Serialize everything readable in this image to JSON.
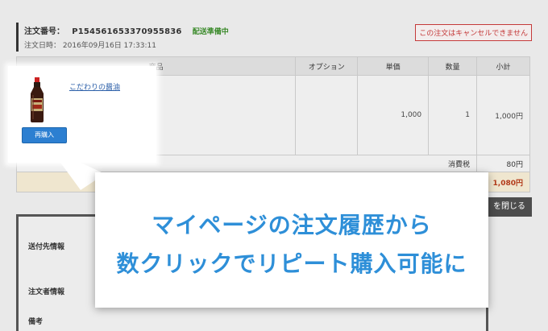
{
  "order": {
    "number_label": "注文番号：",
    "number": "P154561653370955836",
    "status": "配送準備中",
    "date_label": "注文日時：",
    "date": "2016年09月16日 17:33:11",
    "cancel_notice": "この注文はキャンセルできません"
  },
  "table": {
    "headers": [
      "商品",
      "オプション",
      "単価",
      "数量",
      "小計"
    ],
    "item": {
      "name": "こだわりの醤油",
      "option": "",
      "unit_price": "1,000",
      "quantity": "1",
      "subtotal": "1,000円",
      "rebuy_label": "再購入"
    },
    "tax_label": "消費税",
    "tax_value": "80円",
    "total_value": "1,080円"
  },
  "close_label": "を閉じる",
  "panel": {
    "shipping_label": "送付先情報",
    "orderer_label": "注文者情報",
    "notes_label": "備考"
  },
  "callout": {
    "line1": "マイページの注文履歴から",
    "line2": "数クリックでリピート購入可能に"
  },
  "colors": {
    "accent_blue": "#2e8fd8",
    "button_blue": "#2c7fd1",
    "status_green": "#3a8a2a",
    "warning_red": "#c43a3a",
    "total_bg": "#efe6cf"
  }
}
